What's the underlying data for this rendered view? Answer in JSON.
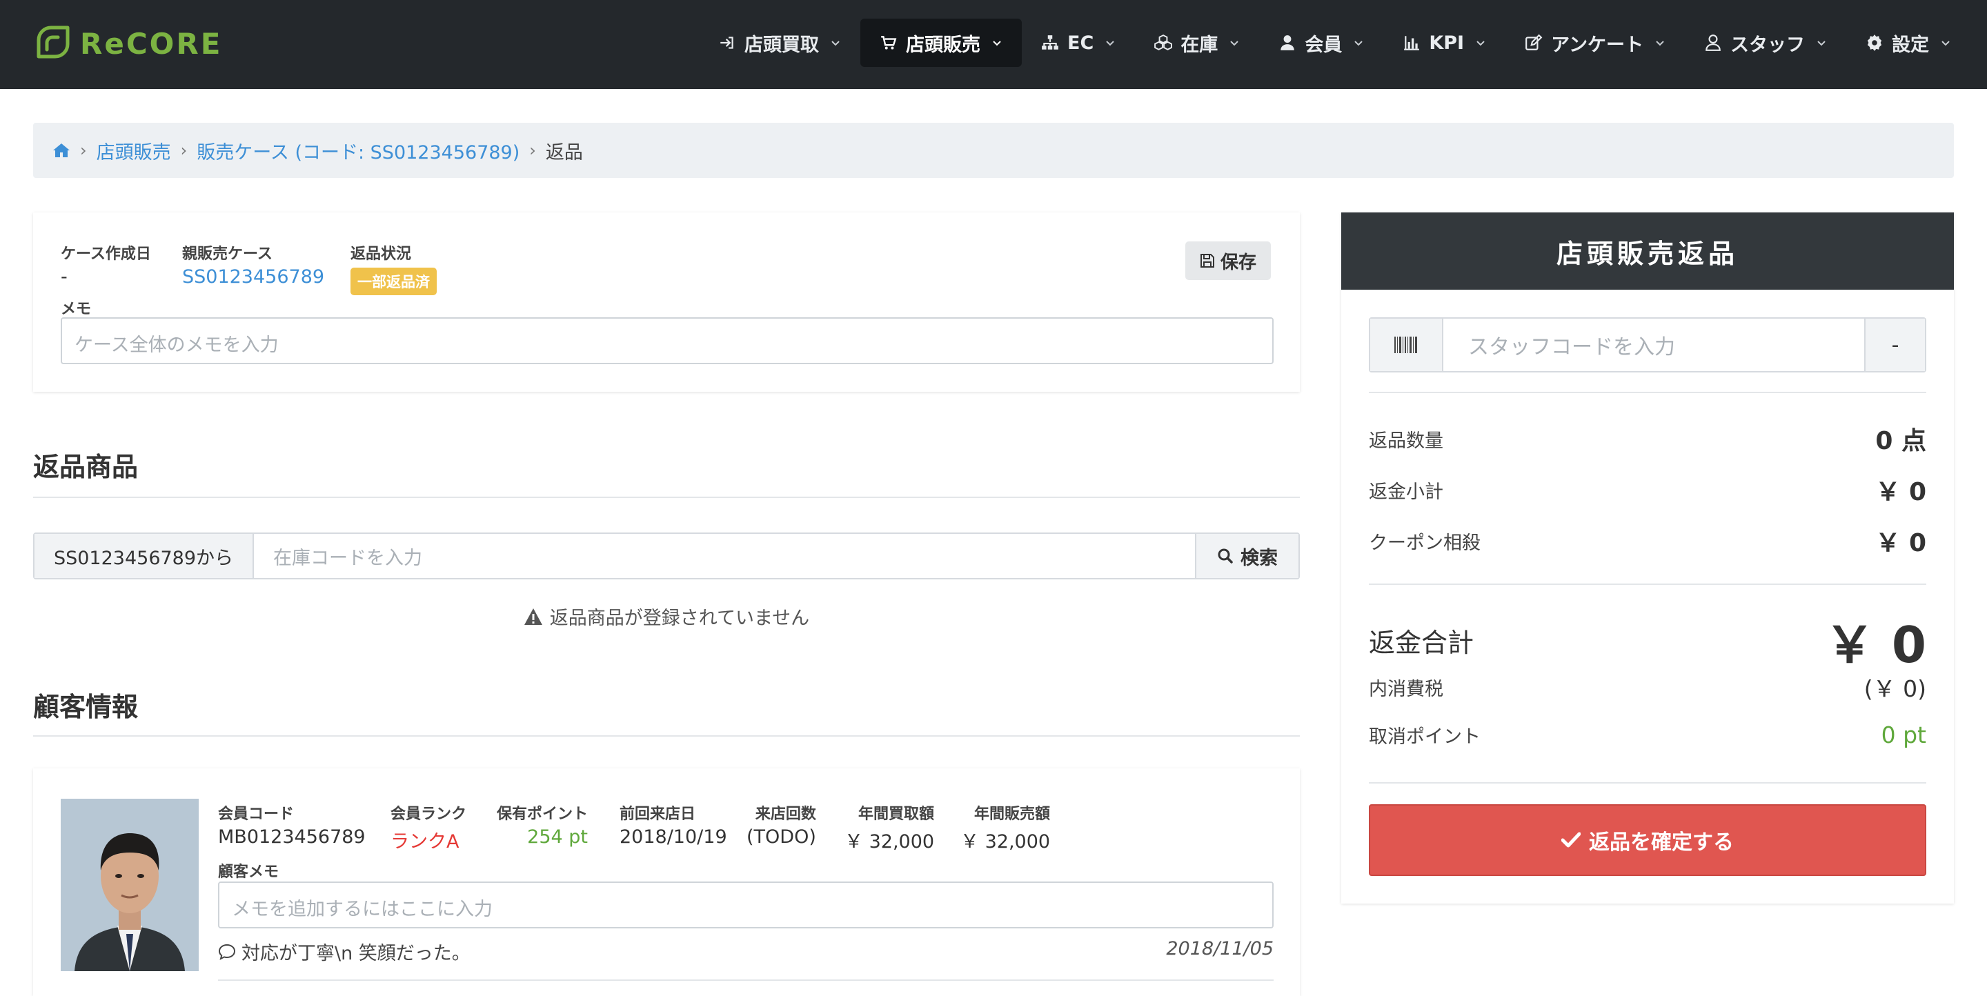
{
  "brand": {
    "name": "ReCORE",
    "color": "#7cb342"
  },
  "nav": {
    "items": [
      {
        "label": "店頭買取",
        "icon": "sign-in-icon",
        "active": false
      },
      {
        "label": "店頭販売",
        "icon": "cart-icon",
        "active": true
      },
      {
        "label": "EC",
        "icon": "sitemap-icon",
        "active": false
      },
      {
        "label": "在庫",
        "icon": "cubes-icon",
        "active": false
      },
      {
        "label": "会員",
        "icon": "user-icon",
        "active": false
      },
      {
        "label": "KPI",
        "icon": "bar-chart-icon",
        "active": false
      },
      {
        "label": "アンケート",
        "icon": "edit-icon",
        "active": false
      },
      {
        "label": "スタッフ",
        "icon": "user-outline-icon",
        "active": false
      },
      {
        "label": "設定",
        "icon": "gear-icon",
        "active": false
      }
    ]
  },
  "breadcrumb": {
    "home_icon": "home-icon",
    "items": [
      "店頭販売",
      "販売ケース (コード: SS0123456789)"
    ],
    "current": "返品"
  },
  "case": {
    "created_label": "ケース作成日",
    "created_value": "-",
    "parent_label": "親販売ケース",
    "parent_value": "SS0123456789",
    "status_label": "返品状況",
    "status_value": "一部返品済",
    "save_label": "保存",
    "memo_label": "メモ",
    "memo_placeholder": "ケース全体のメモを入力"
  },
  "returns": {
    "title": "返品商品",
    "prefix": "SS0123456789から",
    "placeholder": "在庫コードを入力",
    "search_label": "検索",
    "empty_message": "返品商品が登録されていません"
  },
  "customer": {
    "title": "顧客情報",
    "fields": [
      {
        "label": "会員コード",
        "value": "MB0123456789"
      },
      {
        "label": "会員ランク",
        "value": "ランクA"
      },
      {
        "label": "保有ポイント",
        "value": "254 pt"
      },
      {
        "label": "前回来店日",
        "value": "2018/10/19"
      },
      {
        "label": "来店回数",
        "value": "(TODO)"
      },
      {
        "label": "年間買取額",
        "value": "￥ 32,000"
      },
      {
        "label": "年間販売額",
        "value": "￥ 32,000"
      }
    ],
    "memo_label": "顧客メモ",
    "memo_placeholder": "メモを追加するにはここに入力",
    "note_text": "対応が丁寧\\n 笑顔だった。",
    "note_date": "2018/11/05"
  },
  "panel": {
    "title": "店頭販売返品",
    "staff_placeholder": "スタッフコードを入力",
    "staff_button": "-",
    "rows": [
      {
        "label": "返品数量",
        "value": "0 点"
      },
      {
        "label": "返金小計",
        "value": "￥ 0"
      },
      {
        "label": "クーポン相殺",
        "value": "￥ 0"
      }
    ],
    "total_label": "返金合計",
    "total_value": "￥ 0",
    "tax_label": "内消費税",
    "tax_value": "(￥ 0)",
    "cancel_point_label": "取消ポイント",
    "cancel_point_value": "0 pt",
    "confirm_label": "返品を確定する",
    "confirm_color": "#e05650"
  }
}
